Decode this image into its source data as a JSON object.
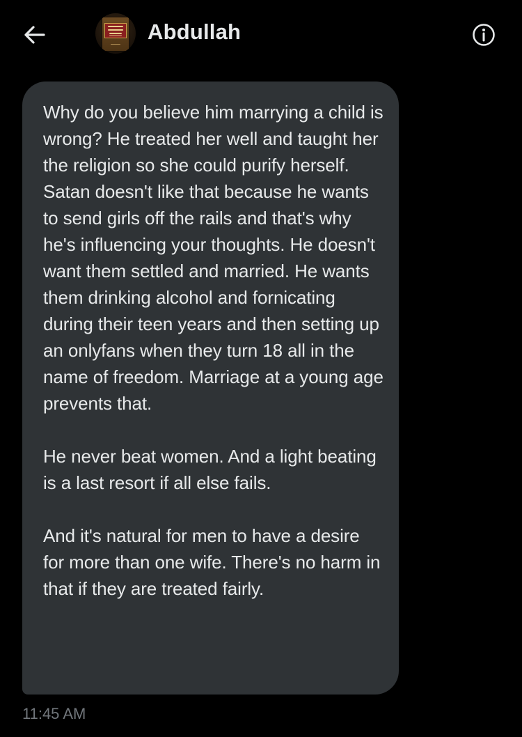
{
  "header": {
    "back_icon": "arrow-left-icon",
    "contact_name": "Abdullah",
    "avatar_icon": "book-cover-avatar",
    "avatar_text": "KITAB AT-TAUHID The Book of Monotheism",
    "info_icon": "info-circle-icon"
  },
  "message": {
    "paragraphs": [
      "Why do you believe him marrying a child is wrong? He treated her well and taught her the religion so she could purify herself. Satan doesn't like that because he wants to send girls off the rails and that's why he's influencing your thoughts. He doesn't want them settled and married. He wants them drinking alcohol and fornicating during their teen years and then setting up an onlyfans when they turn 18 all in the name of freedom. Marriage at a young age prevents that.",
      "He never beat women. And a light beating is a last resort if all else fails.",
      "And it's natural for men to have a desire for more than one wife. There's no harm in that if they are treated fairly."
    ],
    "timestamp": "11:45 AM"
  },
  "colors": {
    "background": "#000000",
    "bubble": "#2f3336",
    "text": "#e7e9ea",
    "muted": "#71767b"
  }
}
